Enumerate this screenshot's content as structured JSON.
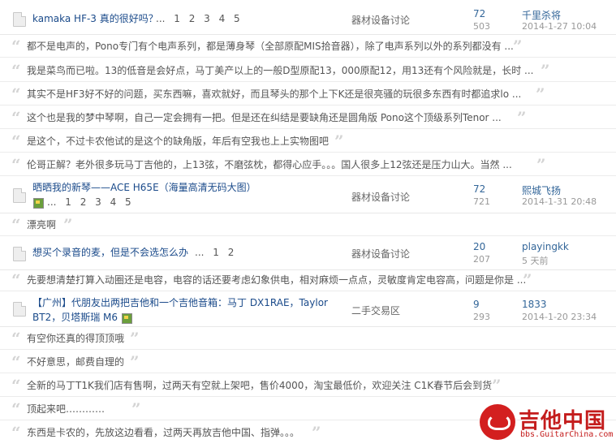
{
  "threads": [
    {
      "title": "kamaka HF-3 真的很好吗？",
      "pages": "... 1 2 3 4 5",
      "forum": "器材设备讨论",
      "replies": "72",
      "views": "503",
      "author": "千里杀将",
      "date": "2014-1-27 10:04"
    },
    {
      "title": "晒晒我的新琴——ACE H65E（海量高清无码大图）",
      "pages": "... 1 2 3 4 5",
      "forum": "器材设备讨论",
      "replies": "72",
      "views": "721",
      "author": "熙城飞扬",
      "date": "2014-1-31 20:48"
    },
    {
      "title": "想买个录音的麦，但是不会选怎么办",
      "pages": "... 1 2",
      "forum": "器材设备讨论",
      "replies": "20",
      "views": "207",
      "author": "playingkk",
      "date": "5 天前"
    },
    {
      "title_line1": "【广州】代朋友出两把吉他和一个吉他音箱：马丁 DX1RAE，Taylor",
      "title_line2": "BT2，贝塔斯瑞 M6",
      "forum": "二手交易区",
      "replies": "9",
      "views": "293",
      "author": "1833",
      "date": "2014-1-20 23:34"
    }
  ],
  "quotes": {
    "t1": [
      "都不是电声的，Pono专门有个电声系列，都是薄身琴（全部原配MIS拾音器），除了电声系列以外的系列都没有 ...",
      "我是菜鸟而已啦。13的低音是会好点，马丁美产以上的一般D型原配13，000原配12，用13还有个风险就是，长时 ...",
      "其实不是HF3好不好的问题，买东西嘛，喜欢就好，而且琴头的那个上下K还是很亮骚的玩很多东西有时都追求lo ...",
      "这个也是我的梦中琴啊，自己一定会拥有一把。但是还在纠结是要缺角还是圆角版 Pono这个顶级系列Tenor ...",
      "是这个，不过卡农他试的是这个的缺角版，年后有空我也上上实物图吧",
      "伦哥正解？老外很多玩马丁吉他的，上13弦，不磨弦枕，都得心应手。。。国人很多上12弦还是压力山大。当然 ..."
    ],
    "t2": [
      "漂亮啊"
    ],
    "t3": [
      "先要想清楚打算入动圈还是电容，电容的话还要考虑幻象供电，相对麻烦一点点，灵敏度肯定电容高，问题是你是 ..."
    ],
    "t4": [
      "有空你还真的得顶顶哦",
      "不好意思，邮费自理的",
      "全新的马丁T1K我们店有售啊，过两天有空就上架吧，售价4000，淘宝最低价，欢迎关注 C1K春节后会到货",
      "顶起来吧…………",
      "东西是卡农的，先放这边看看，过两天再放吉他中国、指弹。。。"
    ]
  },
  "quote_marks": {
    "open": "“",
    "close": "”"
  },
  "watermark": {
    "site_name": "吉他中国",
    "url": "bbs.GuitarChina.com"
  },
  "colors": {
    "title": "#1a4a8a",
    "link": "#336699",
    "muted": "#999999",
    "brand_red": "#c41c1c"
  }
}
